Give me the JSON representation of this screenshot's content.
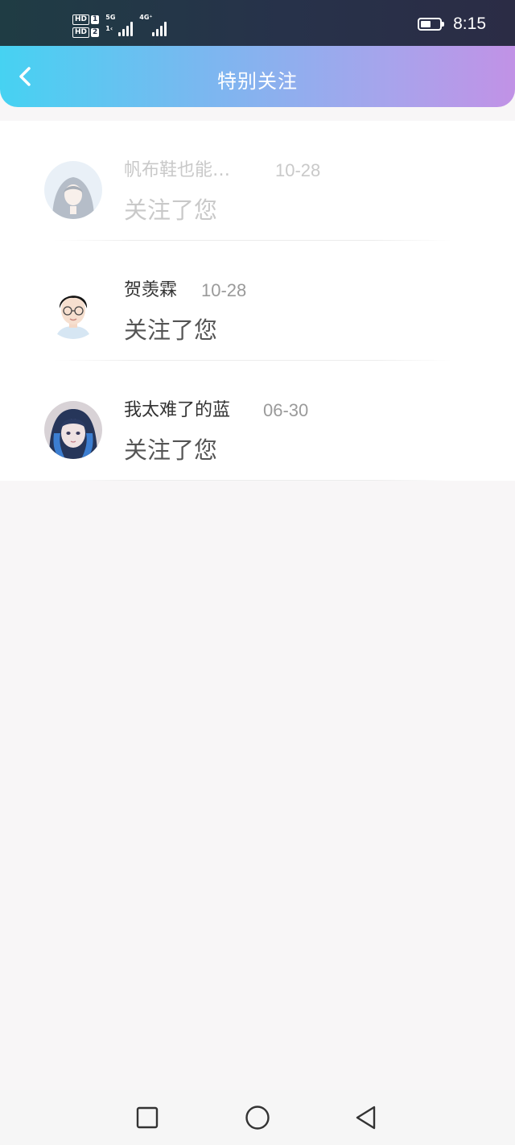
{
  "status_bar": {
    "sim1_label": "HD",
    "sim1_num": "1",
    "sim2_label": "HD",
    "sim2_num": "2",
    "net1_type": "5G",
    "net1_sub": "1‹",
    "net2_type": "4G⁺",
    "time": "8:15",
    "battery_level": 0.55
  },
  "header": {
    "title": "特别关注",
    "back_icon": "chevron-left-icon",
    "gradient": [
      "#46d2f2",
      "#c192e6"
    ]
  },
  "followers": [
    {
      "name": "帆布鞋也能…",
      "date": "10-28",
      "action": "关注了您",
      "avatar": "hooded-girl-avatar",
      "faded": true
    },
    {
      "name": "贺羡霖",
      "date": "10-28",
      "action": "关注了您",
      "avatar": "boy-glasses-avatar",
      "faded": false
    },
    {
      "name": "我太难了的蓝",
      "date": "06-30",
      "action": "关注了您",
      "avatar": "blue-hair-girl-avatar",
      "faded": false
    }
  ],
  "nav": {
    "recent_icon": "square-icon",
    "home_icon": "circle-icon",
    "back_icon": "triangle-back-icon"
  }
}
